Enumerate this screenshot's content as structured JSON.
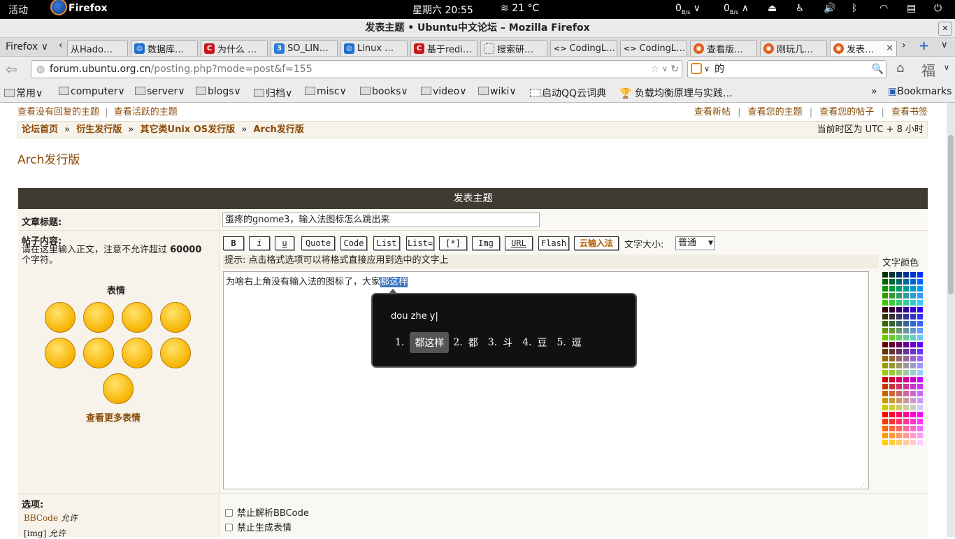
{
  "gnome": {
    "activities": "活动",
    "app": "Firefox",
    "clock": "星期六  20:55",
    "weather": "21 °C",
    "net1": "0",
    "net2": "0",
    "net_unit": "B/s"
  },
  "window": {
    "title": "发表主题  •  Ubuntu中文论坛  –  Mozilla Firefox"
  },
  "tabs": {
    "menu": "Firefox",
    "items": [
      "从Hado…",
      "数据库…",
      "为什么 …",
      "SO_LIN…",
      "Linux …",
      "基于redi…",
      "搜索研…",
      "CodingL…",
      "CodingL…",
      "查看版…",
      "刚玩几…",
      "发表…"
    ]
  },
  "nav": {
    "url_host": "forum.ubuntu.org.cn",
    "url_path": "/posting.php?mode=post&f=155",
    "search_value": "的"
  },
  "bookmarks": {
    "items": [
      "常用",
      "computer",
      "server",
      "blogs",
      "归档",
      "misc",
      "books",
      "video",
      "wiki"
    ],
    "qq": "启动QQ云词典",
    "lb": "负载均衡原理与实践…",
    "more": "»",
    "bm": "Bookmarks"
  },
  "forum": {
    "top_left": [
      "查看没有回复的主题",
      "查看活跃的主题"
    ],
    "top_right": [
      "查看新帖",
      "查看您的主题",
      "查看您的帖子",
      "查看书签"
    ],
    "crumbs": [
      "论坛首页",
      "衍生发行版",
      "其它类Unix OS发行版",
      "Arch发行版"
    ],
    "sep": "»",
    "timezone": "当前时区为 UTC + 8 小时",
    "forum_title": "Arch发行版",
    "post_header": "发表主题",
    "subject_label": "文章标题:",
    "subject_value": "蛋疼的gnome3，输入法图标怎么跳出来",
    "body_label": "帖子内容:",
    "body_hint_1": "请在这里输入正文，注意不允许超过 ",
    "body_limit": "60000",
    "body_hint_2": "个字符。",
    "smilies_label": "表情",
    "more_smilies": "查看更多表情",
    "buttons": [
      "B",
      "i",
      "u",
      "Quote",
      "Code",
      "List",
      "List=",
      "[*]",
      "Img",
      "URL",
      "Flash",
      "云输入法"
    ],
    "font_size_label": "文字大小:",
    "font_size_value": "普通",
    "tip": "提示: 点击格式选项可以将格式直接应用到选中的文字上",
    "color_label": "文字颜色",
    "text_plain": "为啥右上角没有输入法的图标了，大家",
    "text_preedit": "都这样",
    "options_label": "选项:",
    "opt_bbcode": "BBCode",
    "opt_bbcode_val": "允许",
    "opt_img": "[img]",
    "opt_img_val": "允许",
    "chk1": "禁止解析BBCode",
    "chk2": "禁止生成表情"
  },
  "ime": {
    "input": "dou zhe y",
    "candidates": [
      {
        "n": "1.",
        "t": "都这样"
      },
      {
        "n": "2.",
        "t": "都"
      },
      {
        "n": "3.",
        "t": "斗"
      },
      {
        "n": "4.",
        "t": "豆"
      },
      {
        "n": "5.",
        "t": "逗"
      }
    ]
  }
}
